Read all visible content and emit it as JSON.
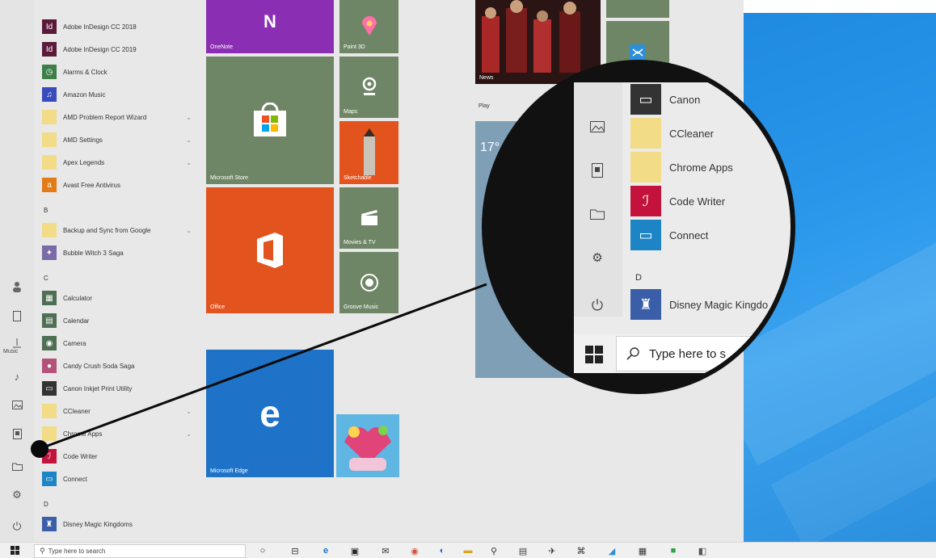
{
  "colors": {
    "desktop_blue": "#2b93e6",
    "tile_gray_green": "#6f8666",
    "office_orange": "#e2531d",
    "edge_blue": "#1e73c8",
    "onenote_purple": "#8a2fb3",
    "code_writer_red": "#c3123b",
    "connect_blue": "#1d84c6",
    "folder_yellow": "#f2dc87"
  },
  "rail": {
    "music_label": "Music",
    "icons": [
      "user-icon",
      "document-icon",
      "music-icon",
      "pictures-icon",
      "videos-icon",
      "folder-icon",
      "settings-icon",
      "power-icon"
    ]
  },
  "applist": {
    "apps": [
      {
        "label": "Adobe InDesign CC 2018",
        "icon": "indesign-icon",
        "color": "#5b1a3a"
      },
      {
        "label": "Adobe InDesign CC 2019",
        "icon": "indesign-icon",
        "color": "#5b1a3a"
      },
      {
        "label": "Alarms & Clock",
        "icon": "clock-icon",
        "color": "#3e7f49"
      },
      {
        "label": "Amazon Music",
        "icon": "music-app-icon",
        "color": "#3a4bbd"
      },
      {
        "label": "AMD Problem Report Wizard",
        "icon": "folder-icon",
        "color": "#f2dc87"
      },
      {
        "label": "AMD Settings",
        "icon": "folder-icon",
        "color": "#f2dc87"
      },
      {
        "label": "Apex Legends",
        "icon": "folder-icon",
        "color": "#f2dc87"
      },
      {
        "label": "Avast Free Antivirus",
        "icon": "antivirus-icon",
        "color": "#e37b17"
      }
    ],
    "letter_b": "B",
    "apps_b": [
      {
        "label": "Backup and Sync from Google",
        "icon": "folder-icon",
        "color": "#f2dc87"
      },
      {
        "label": "Bubble Witch 3 Saga",
        "icon": "game-icon",
        "color": "#7b6aa8"
      }
    ],
    "letter_c": "C",
    "apps_c": [
      {
        "label": "Calculator",
        "icon": "calculator-icon",
        "color": "#4f6f54"
      },
      {
        "label": "Calendar",
        "icon": "calendar-icon",
        "color": "#4f6f54"
      },
      {
        "label": "Camera",
        "icon": "camera-icon",
        "color": "#4f6f54"
      },
      {
        "label": "Candy Crush Soda Saga",
        "icon": "candy-icon",
        "color": "#b4527a"
      },
      {
        "label": "Canon Inkjet Print Utility",
        "icon": "printer-icon",
        "color": "#333333"
      },
      {
        "label": "CCleaner",
        "icon": "folder-icon",
        "color": "#f2dc87"
      },
      {
        "label": "Chrome Apps",
        "icon": "folder-icon",
        "color": "#f2dc87"
      },
      {
        "label": "Code Writer",
        "icon": "code-writer-icon",
        "color": "#c3123b"
      },
      {
        "label": "Connect",
        "icon": "connect-icon",
        "color": "#1d84c6"
      }
    ],
    "letter_d": "D",
    "apps_d": [
      {
        "label": "Disney Magic Kingdoms",
        "icon": "disney-icon",
        "color": "#3a5ea8"
      }
    ]
  },
  "tiles": {
    "onenote": "OneNote",
    "paint3d": "Paint 3D",
    "store": "Microsoft Store",
    "maps": "Maps",
    "sketch": "Sketchable",
    "movies": "Movies & TV",
    "office": "Office",
    "groove": "Groove Music",
    "edge": "Microsoft Edge",
    "news": "News",
    "play_group": "Play",
    "weather_temp": "17°"
  },
  "magnifier": {
    "apps": [
      {
        "label": "Canon",
        "color": "#333333"
      },
      {
        "label": "CCleaner",
        "color": "#f2dc87"
      },
      {
        "label": "Chrome Apps",
        "color": "#f2dc87"
      },
      {
        "label": "Code Writer",
        "color": "#c3123b"
      },
      {
        "label": "Connect",
        "color": "#1d84c6"
      }
    ],
    "letter": "D",
    "disney": "Disney Magic Kingdo",
    "search_text": "Type here to s"
  },
  "taskbar": {
    "search_placeholder": "Type here to search"
  }
}
